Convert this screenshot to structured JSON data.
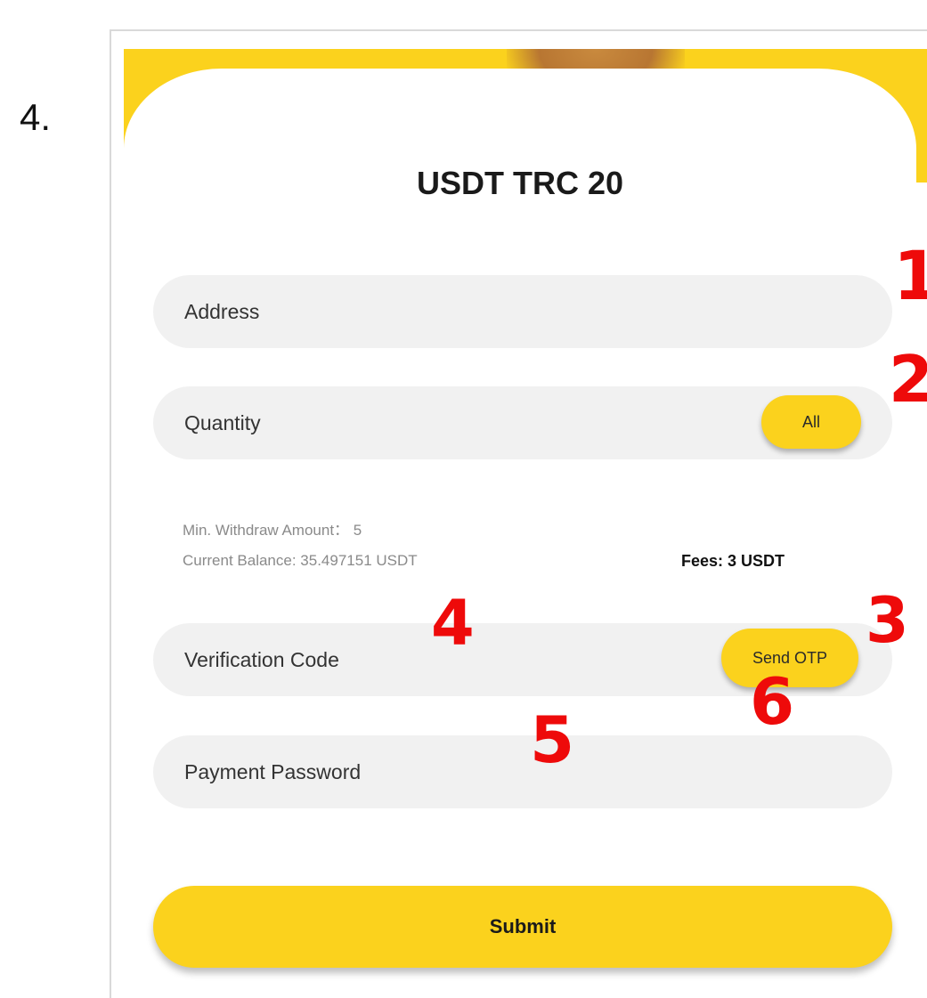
{
  "step_number": "4.",
  "form": {
    "title": "USDT TRC 20",
    "address": {
      "placeholder": "Address"
    },
    "quantity": {
      "placeholder": "Quantity",
      "all_button": "All"
    },
    "info": {
      "min_withdraw": "Min. Withdraw Amount： 5",
      "current_balance": "Current Balance: 35.497151 USDT",
      "fees": "Fees:  3 USDT"
    },
    "verification_code": {
      "placeholder": "Verification Code",
      "send_otp_button": "Send OTP"
    },
    "payment_password": {
      "placeholder": "Payment Password"
    },
    "submit_button": "Submit"
  },
  "annotations": {
    "a1": "1",
    "a2": "2",
    "a3": "3",
    "a4": "4",
    "a5": "5",
    "a6": "6"
  },
  "colors": {
    "accent_yellow": "#fbd21d",
    "annotation_red": "#ee0a0a",
    "field_bg": "#f1f1f1"
  }
}
